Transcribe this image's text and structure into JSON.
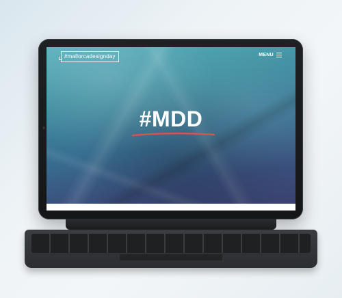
{
  "site": {
    "logo_text": "#mallorcadesignday",
    "menu_label": "MENU",
    "hero_title": "#MDD"
  },
  "colors": {
    "accent_underline": "#d9534f",
    "hero_text": "#ffffff",
    "device_frame": "#1b1d1f"
  },
  "icons": {
    "menu": "hamburger-icon"
  }
}
